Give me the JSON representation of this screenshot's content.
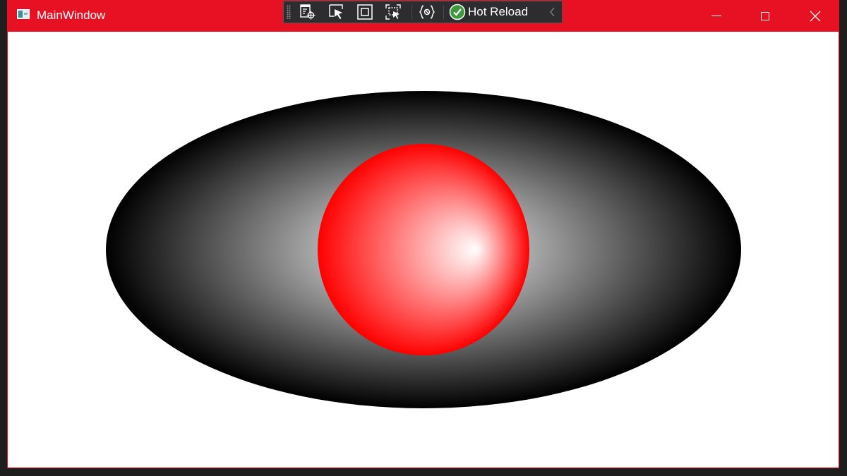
{
  "window": {
    "title": "MainWindow",
    "accent_color": "#e81123",
    "caption_buttons": [
      "minimize-icon",
      "maximize-icon",
      "close-icon"
    ]
  },
  "hot_reload_toolbar": {
    "tools": [
      "go-to-live-visual-tree-icon",
      "select-element-icon",
      "display-layout-adorners-icon",
      "track-focused-element-icon",
      "binding-failures-icon"
    ],
    "hot_reload_label": "Hot Reload",
    "hot_reload_status_color": "#3c9a3c",
    "collapse_icon": "chevron-left-icon"
  },
  "canvas": {
    "ellipse": {
      "gradient": "radial",
      "center_color": "#ffffff",
      "edge_color": "#000000"
    },
    "circle": {
      "gradient": "radial",
      "highlight_color": "#ffffff",
      "edge_color": "#ff0000"
    }
  }
}
